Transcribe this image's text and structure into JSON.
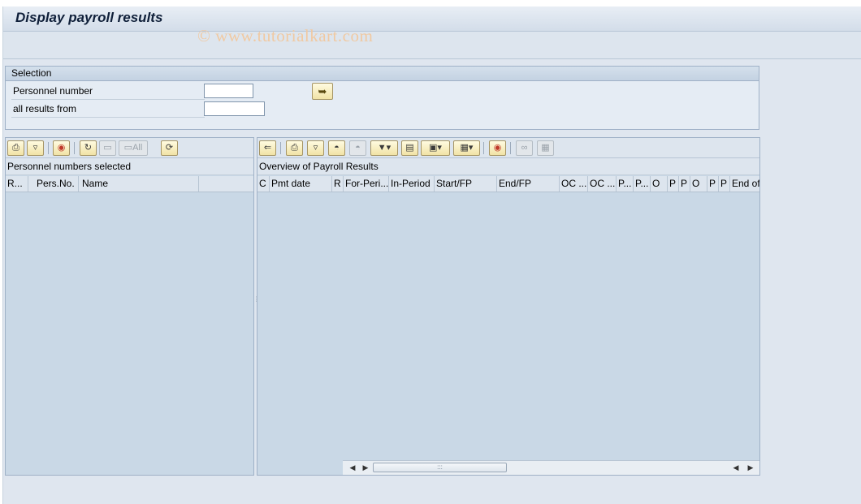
{
  "title": "Display payroll results",
  "watermark": "© www.tutorialkart.com",
  "selection": {
    "header": "Selection",
    "personnel_number_label": "Personnel number",
    "personnel_number_value": "",
    "all_results_from_label": "all results from",
    "all_results_from_value": "",
    "execute_icon": "execute-arrow-icon"
  },
  "left_panel": {
    "title": "Personnel numbers selected",
    "toolbar_icons": [
      "print-icon",
      "filter-icon",
      "color-legend-icon",
      "select-all-icon",
      "delete-icon",
      "delete-all-icon",
      "refresh-icon"
    ],
    "delete_all_label": "All",
    "columns": [
      "R...",
      "Pers.No.",
      "Name"
    ]
  },
  "right_panel": {
    "title": "Overview of Payroll Results",
    "toolbar_icons": [
      "back-icon",
      "print-icon",
      "filter-icon",
      "find-icon",
      "find-next-icon",
      "set-filter-icon",
      "print-preview-icon",
      "export-icon",
      "layout-icon",
      "color-legend-icon",
      "glasses-icon",
      "columns-icon"
    ],
    "columns": [
      "C",
      "Pmt date",
      "R",
      "For-Peri...",
      "In-Period",
      "Start/FP",
      "End/FP",
      "OC ...",
      "OC ...",
      "P...",
      "P...",
      "O",
      "P",
      "P",
      "O",
      "P",
      "P",
      "End of"
    ]
  }
}
